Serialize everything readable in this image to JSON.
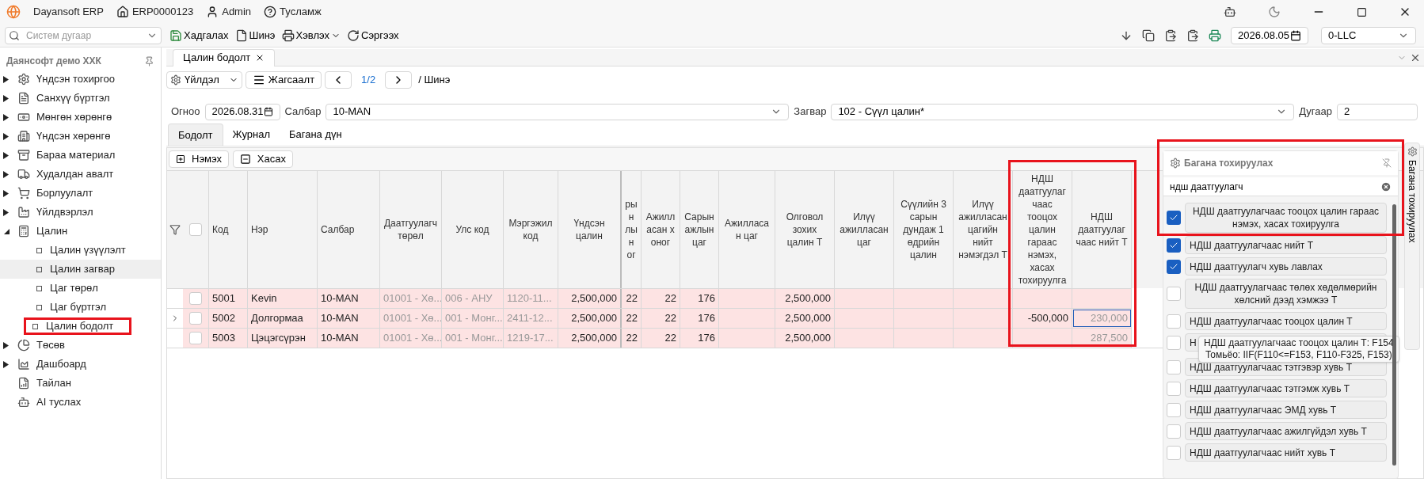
{
  "title_bar": {
    "app": "Dayansoft ERP",
    "menu": [
      {
        "label": "ERP0000123",
        "kind": "home"
      },
      {
        "label": "Admin",
        "kind": "user"
      },
      {
        "label": "Тусламж",
        "kind": "help"
      }
    ]
  },
  "toolbar": {
    "search_placeholder": "Систем дугаар",
    "actions": [
      {
        "label": "Хадгалах",
        "kind": "save"
      },
      {
        "label": "Шинэ",
        "kind": "new"
      },
      {
        "label": "Хэвлэх",
        "kind": "print"
      },
      {
        "label": "Сэргээх",
        "kind": "refresh"
      }
    ],
    "date": "2026.08.05",
    "company": "0-LLC"
  },
  "sidebar": {
    "title": "Даянсофт демо ХХК",
    "items": [
      {
        "label": "Үндсэн тохиргоо",
        "kind": "settings",
        "expanded": false
      },
      {
        "label": "Санхүү бүртгэл",
        "kind": "ledger",
        "expanded": false
      },
      {
        "label": "Мөнгөн хөрөнгө",
        "kind": "money",
        "expanded": false
      },
      {
        "label": "Үндсэн хөрөнгө",
        "kind": "building",
        "expanded": false
      },
      {
        "label": "Бараа материал",
        "kind": "stock",
        "expanded": false
      },
      {
        "label": "Худалдан авалт",
        "kind": "purchase",
        "expanded": false
      },
      {
        "label": "Борлуулалт",
        "kind": "cart",
        "expanded": false
      },
      {
        "label": "Үйлдвэрлэл",
        "kind": "factory",
        "expanded": false
      },
      {
        "label": "Цалин",
        "kind": "calculator",
        "expanded": true,
        "children": [
          {
            "label": "Цалин үзүүлэлт",
            "selected": false,
            "highlighted": false
          },
          {
            "label": "Цалин загвар",
            "selected": true,
            "highlighted": false
          },
          {
            "label": "Цаг төрөл",
            "selected": false,
            "highlighted": false
          },
          {
            "label": "Цаг бүртгэл",
            "selected": false,
            "highlighted": false
          },
          {
            "label": "Цалин бодолт",
            "selected": false,
            "highlighted": true
          }
        ]
      },
      {
        "label": "Төсөв",
        "kind": "pie",
        "expanded": false
      },
      {
        "label": "Дашбоард",
        "kind": "dashboard",
        "expanded": false
      },
      {
        "label": "Тайлан",
        "kind": "report"
      },
      {
        "label": "AI туслах",
        "kind": "robot"
      }
    ]
  },
  "document_tab": {
    "label": "Цалин бодолт"
  },
  "actions": {
    "menu": "Үйлдэл",
    "list": "Жагсаалт",
    "pager": "1/2",
    "breadcrumb": "/ Шинэ"
  },
  "form": {
    "fields": [
      {
        "label": "Огноо",
        "value": "2026.08.31",
        "kind": "date"
      },
      {
        "label": "Салбар",
        "value": "10-MAN",
        "kind": "select"
      },
      {
        "label": "Загвар",
        "value": "102 - Сүүл цалин*",
        "kind": "select"
      },
      {
        "label": "Дугаар",
        "value": "2",
        "kind": "text"
      }
    ]
  },
  "sub_tabs": [
    {
      "label": "Бодолт",
      "selected": true
    },
    {
      "label": "Журнал",
      "selected": false
    },
    {
      "label": "Багана дүн",
      "selected": false
    }
  ],
  "grid": {
    "add": "Нэмэх",
    "remove": "Хасах",
    "all_checked": false,
    "columns": [
      {
        "label": "Код",
        "kind": "text",
        "highlighted": false,
        "focused": false
      },
      {
        "label": "Нэр",
        "kind": "text",
        "highlighted": false,
        "focused": false
      },
      {
        "label": "Салбар",
        "kind": "text",
        "highlighted": false,
        "focused": false
      },
      {
        "label": "Даатгуулагч төрөл",
        "kind": "lookup",
        "highlighted": false,
        "focused": false
      },
      {
        "label": "Улс код",
        "kind": "lookup",
        "highlighted": false,
        "focused": false
      },
      {
        "label": "Мэргэжил код",
        "kind": "lookup",
        "highlighted": false,
        "focused": false
      },
      {
        "label": "Үндсэн цалин",
        "kind": "number",
        "highlighted": false,
        "focused": false
      },
      {
        "label": "рын лын ог",
        "kind": "number",
        "highlighted": false,
        "focused": false
      },
      {
        "label": "Ажилласан хоног",
        "kind": "number",
        "highlighted": false,
        "focused": false
      },
      {
        "label": "Сарын ажлын цаг",
        "kind": "number",
        "highlighted": false,
        "focused": false
      },
      {
        "label": "Ажилласан цаг",
        "kind": "number",
        "highlighted": false,
        "focused": false
      },
      {
        "label": "Олговол зохих цалин Т",
        "kind": "computed",
        "highlighted": false,
        "focused": false
      },
      {
        "label": "Илүү ажилласан цаг",
        "kind": "number",
        "highlighted": false,
        "focused": false
      },
      {
        "label": "Сүүлийн 3 сарын дундаж 1 өдрийн цалин",
        "kind": "computed",
        "highlighted": false,
        "focused": false
      },
      {
        "label": "Илүү ажилласан цагийн нийт нэмэгдэл Т",
        "kind": "computed",
        "highlighted": false,
        "focused": false
      },
      {
        "label": "НДШ даатгуулаг чаас тооцох цалин гараас нэмэх, хасах тохируулга",
        "kind": "number",
        "highlighted": true,
        "focused": false
      },
      {
        "label": "НДШ даатгуулаг чаас нийт Т",
        "kind": "computed",
        "highlighted": true,
        "focused": true
      }
    ],
    "rows": [
      {
        "selected": false,
        "checked": false,
        "cells": [
          "5001",
          "Kevin",
          "10-MAN",
          "01001 - Хө...",
          "006 - АНУ",
          "1120-11...",
          "2,500,000",
          "22",
          "22",
          "176",
          null,
          "2,500,000",
          null,
          null,
          null,
          null,
          null
        ]
      },
      {
        "selected": true,
        "checked": false,
        "cells": [
          "5002",
          "Долгормаа",
          "10-MAN",
          "01001 - Хө...",
          "001 - Монг...",
          "2411-12...",
          "2,500,000",
          "22",
          "22",
          "176",
          null,
          "2,500,000",
          null,
          null,
          null,
          "-500,000",
          "230,000"
        ]
      },
      {
        "selected": false,
        "checked": false,
        "cells": [
          "5003",
          "Цэцэгсүрэн",
          "10-MAN",
          "01001 - Хө...",
          "001 - Монг...",
          "1219-17...",
          "2,500,000",
          "22",
          "22",
          "176",
          null,
          "2,500,000",
          null,
          null,
          null,
          null,
          "287,500"
        ]
      }
    ]
  },
  "column_panel": {
    "title": "Багана тохируулах",
    "highlighted": true,
    "search": "ндш даатгуулагч",
    "side_tab": "Багана тохируулах",
    "items": [
      {
        "label": "НДШ даатгуулагчаас тооцох цалин гараас нэмэх, хасах тохируулга",
        "checked": true
      },
      {
        "label": "НДШ даатгуулагчаас нийт Т",
        "checked": true
      },
      {
        "label": "НДШ даатгуулагч хувь лавлах",
        "checked": true
      },
      {
        "label": "НДШ даатгуулагчаас төлөх хөдөлмөрийн хөлсний дээд хэмжээ Т",
        "checked": false
      },
      {
        "label": "НДШ даатгуулагчаас тооцох цалин Т",
        "checked": false
      },
      {
        "label": "Н",
        "checked": false
      },
      {
        "label": "НДШ даатгуулагчаас тэтгэвэр хувь Т",
        "checked": false
      },
      {
        "label": "НДШ даатгуулагчаас тэтгэмж хувь Т",
        "checked": false
      },
      {
        "label": "НДШ даатгуулагчаас ЭМД хувь Т",
        "checked": false
      },
      {
        "label": "НДШ даатгуулагчаас ажилгүйдэл хувь Т",
        "checked": false
      },
      {
        "label": "НДШ даатгуулагчаас нийт хувь Т",
        "checked": false
      }
    ],
    "tooltip": [
      "НДШ даатгуулагчаас тооцох цалин Т: F154",
      "Томьёо: IIF(F110<=F153, F110-F325, F153)"
    ]
  }
}
